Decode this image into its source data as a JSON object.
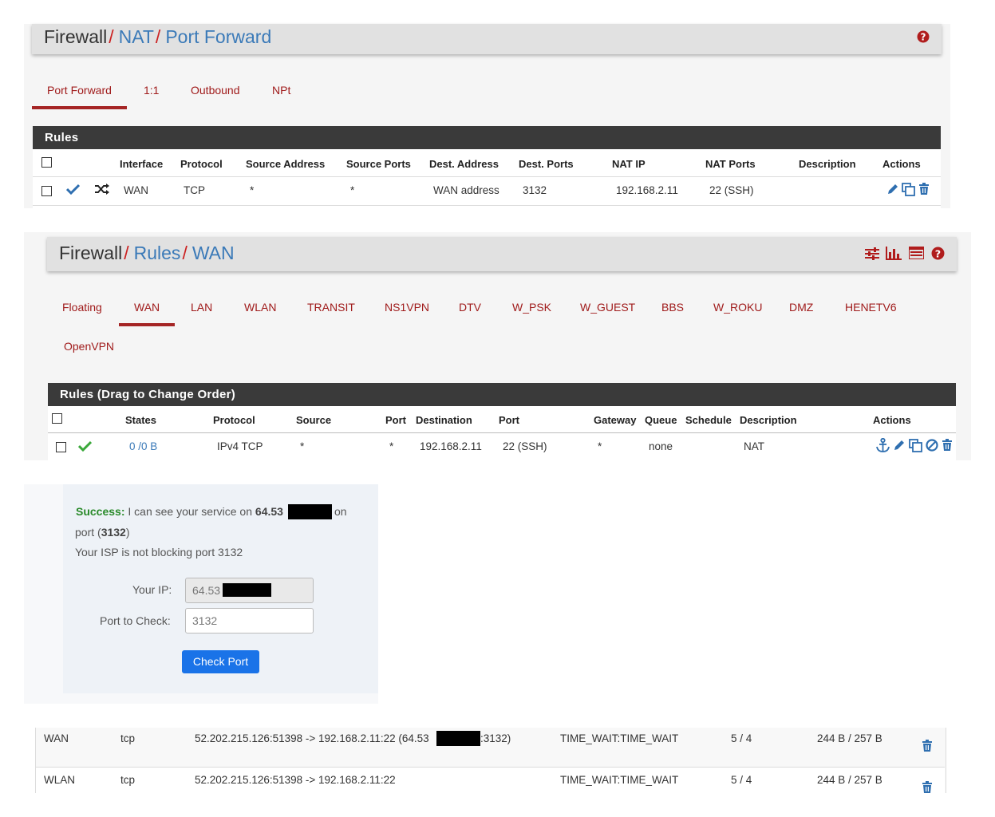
{
  "nat": {
    "breadcrumb": {
      "root": "Firewall",
      "sep": "/",
      "level1": "NAT",
      "level2": "Port Forward"
    },
    "tabs": [
      "Port Forward",
      "1:1",
      "Outbound",
      "NPt"
    ],
    "active_tab": "Port Forward",
    "section_title": "Rules",
    "columns": [
      "Interface",
      "Protocol",
      "Source Address",
      "Source Ports",
      "Dest. Address",
      "Dest. Ports",
      "NAT IP",
      "NAT Ports",
      "Description",
      "Actions"
    ],
    "row": {
      "interface": "WAN",
      "protocol": "TCP",
      "source_address": "*",
      "source_ports": "*",
      "dest_address": "WAN address",
      "dest_ports": "3132",
      "nat_ip": "192.168.2.11",
      "nat_ports": "22 (SSH)",
      "description": ""
    }
  },
  "wan_rules": {
    "breadcrumb": {
      "root": "Firewall",
      "sep": "/",
      "level1": "Rules",
      "level2": "WAN"
    },
    "tabs": [
      "Floating",
      "WAN",
      "LAN",
      "WLAN",
      "TRANSIT",
      "NS1VPN",
      "DTV",
      "W_PSK",
      "W_GUEST",
      "BBS",
      "W_ROKU",
      "DMZ",
      "HENETV6",
      "OpenVPN"
    ],
    "active_tab": "WAN",
    "section_title": "Rules (Drag to Change Order)",
    "columns": [
      "States",
      "Protocol",
      "Source",
      "Port",
      "Destination",
      "Port",
      "Gateway",
      "Queue",
      "Schedule",
      "Description",
      "Actions"
    ],
    "row": {
      "states": "0 /0 B",
      "protocol": "IPv4 TCP",
      "source": "*",
      "source_port": "*",
      "destination": "192.168.2.11",
      "dest_port": "22 (SSH)",
      "gateway": "*",
      "queue": "none",
      "schedule": "",
      "description": "NAT"
    }
  },
  "port_check": {
    "success_label": "Success:",
    "message_pre": "I can see your service on",
    "ip_prefix": "64.53",
    "message_on": "on",
    "port_pre": "port (",
    "port_value": "3132",
    "port_post": ")",
    "isp_message": "Your ISP is not blocking port 3132",
    "your_ip_label": "Your IP:",
    "your_ip_value": "64.53",
    "port_label": "Port to Check:",
    "port_input_value": "3132",
    "button_label": "Check Port"
  },
  "states": [
    {
      "interface": "WAN",
      "protocol": "tcp",
      "conn_pre": "52.202.215.126:51398 -> 192.168.2.11:22 (64.53",
      "conn_post": ":3132)",
      "state": "TIME_WAIT:TIME_WAIT",
      "packets": "5 / 4",
      "bytes": "244 B / 257 B"
    },
    {
      "interface": "WLAN",
      "protocol": "tcp",
      "conn_pre": "52.202.215.126:51398 -> 192.168.2.11:22",
      "conn_post": "",
      "state": "TIME_WAIT:TIME_WAIT",
      "packets": "5 / 4",
      "bytes": "244 B / 257 B"
    }
  ],
  "colors": {
    "accent_red": "#a01b1b",
    "link_blue": "#3b7ab8",
    "header_dark": "#3a3a3a",
    "button_blue": "#1a73e8",
    "success_green": "#2a8a2a"
  }
}
